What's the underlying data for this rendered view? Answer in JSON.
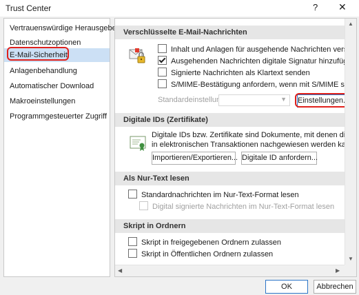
{
  "window": {
    "title": "Trust Center",
    "help": "?",
    "close": "✕"
  },
  "nav": {
    "items": [
      {
        "label": "Vertrauenswürdige Herausgeber"
      },
      {
        "label": "Datenschutzoptionen"
      },
      {
        "label": "E-Mail-Sicherheit"
      },
      {
        "label": "Anlagenbehandlung"
      },
      {
        "label": "Automatischer Download"
      },
      {
        "label": "Makroeinstellungen"
      },
      {
        "label": "Programmgesteuerter Zugriff"
      }
    ],
    "selected": "E-Mail-Sicherheit"
  },
  "encrypted": {
    "header": "Verschlüsselte E-Mail-Nachrichten",
    "icon": "lock-envelope-icon",
    "options": [
      {
        "label": "Inhalt und Anlagen für ausgehende Nachrichten verschlüsseln",
        "checked": false
      },
      {
        "label": "Ausgehenden Nachrichten digitale Signatur hinzufügen",
        "checked": true
      },
      {
        "label": "Signierte Nachrichten als Klartext senden",
        "checked": false
      },
      {
        "label": "S/MIME-Bestätigung anfordern, wenn mit S/MIME signiert",
        "checked": false
      }
    ],
    "default_setting_label": "Standardeinstellung:",
    "default_setting_value": "",
    "settings_button": "Einstellungen..."
  },
  "digital_ids": {
    "header": "Digitale IDs (Zertifikate)",
    "icon": "certificate-icon",
    "description_line1": "Digitale IDs bzw. Zertifikate sind Dokumente, mit denen die Identität",
    "description_line2": "in elektronischen Transaktionen nachgewiesen werden kann.",
    "import_button": "Importieren/Exportieren...",
    "request_button": "Digitale ID anfordern..."
  },
  "plain_text": {
    "header": "Als Nur-Text lesen",
    "options": [
      {
        "label": "Standardnachrichten im Nur-Text-Format lesen",
        "checked": false,
        "disabled": false
      },
      {
        "label": "Digital signierte Nachrichten im Nur-Text-Format lesen",
        "checked": false,
        "disabled": true
      }
    ]
  },
  "folder_script": {
    "header": "Skript in Ordnern",
    "options": [
      {
        "label": "Skript in freigegebenen Ordnern zulassen",
        "checked": false
      },
      {
        "label": "Skript in Öffentlichen Ordnern zulassen",
        "checked": false
      }
    ]
  },
  "footer": {
    "ok": "OK",
    "cancel": "Abbrechen"
  },
  "colors": {
    "highlight": "#e0201b",
    "selected_bg": "#cce0f5",
    "section_bg": "#e6e6e6"
  }
}
